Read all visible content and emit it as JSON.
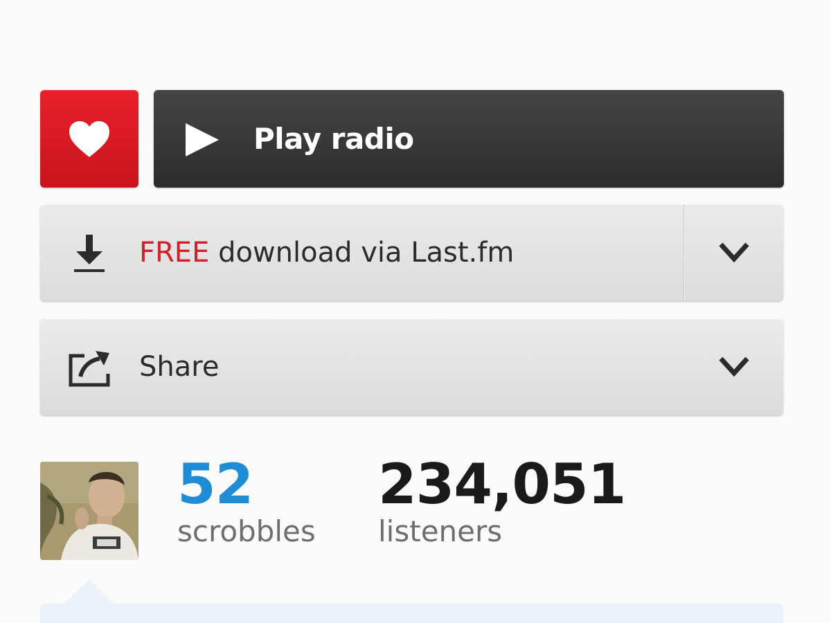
{
  "actions": {
    "love": {
      "icon": "heart-icon",
      "color": "#d81a22"
    },
    "play": {
      "label": "Play radio",
      "icon": "play-icon",
      "color": "#3a3a3a"
    },
    "download": {
      "label_highlight": "FREE",
      "label_rest": " download via Last.fm",
      "highlight_color": "#d0212b",
      "icon": "download-icon",
      "menu_icon": "chevron-down-icon"
    },
    "share": {
      "label": "Share",
      "icon": "share-icon",
      "menu_icon": "chevron-down-icon"
    }
  },
  "stats": {
    "scrobbles": {
      "value": "52",
      "label": "scrobbles",
      "color": "#1f8dd6"
    },
    "listeners": {
      "value": "234,051",
      "label": "listeners"
    }
  },
  "user": {
    "avatar": "user-avatar-photo"
  }
}
